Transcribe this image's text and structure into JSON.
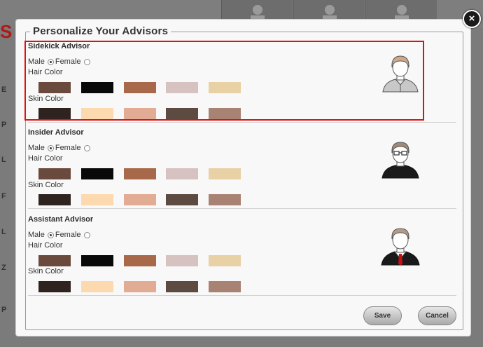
{
  "dialog": {
    "title": "Personalize Your Advisors",
    "close_label": "×"
  },
  "background": {
    "brand_fragment": "S",
    "side_letters": [
      "E",
      "P",
      "L",
      "F",
      "L",
      "Z",
      "P"
    ]
  },
  "labels": {
    "male": "Male",
    "female": "Female",
    "hair_color": "Hair Color",
    "skin_color": "Skin Color"
  },
  "sections": [
    {
      "title": "Sidekick Advisor",
      "selected_gender": "male",
      "highlighted": true
    },
    {
      "title": "Insider Advisor",
      "selected_gender": "male",
      "highlighted": false
    },
    {
      "title": "Assistant Advisor",
      "selected_gender": "male",
      "highlighted": false
    }
  ],
  "hair_colors": [
    "#6a4a3c",
    "#090909",
    "#a8694a",
    "#d6c3c1",
    "#e9d1a6"
  ],
  "skin_colors": [
    "#2f2320",
    "#fdd9b0",
    "#e2ab94",
    "#5d4b42",
    "#a88373"
  ],
  "buttons": {
    "save": "Save",
    "cancel": "Cancel"
  },
  "colors": {
    "highlight": "#e01010"
  },
  "icons": {
    "sidekick_avatar": "person-shirt-avatar-icon",
    "insider_avatar": "person-glasses-avatar-icon",
    "assistant_avatar": "person-suit-tie-avatar-icon",
    "close": "close-icon"
  }
}
